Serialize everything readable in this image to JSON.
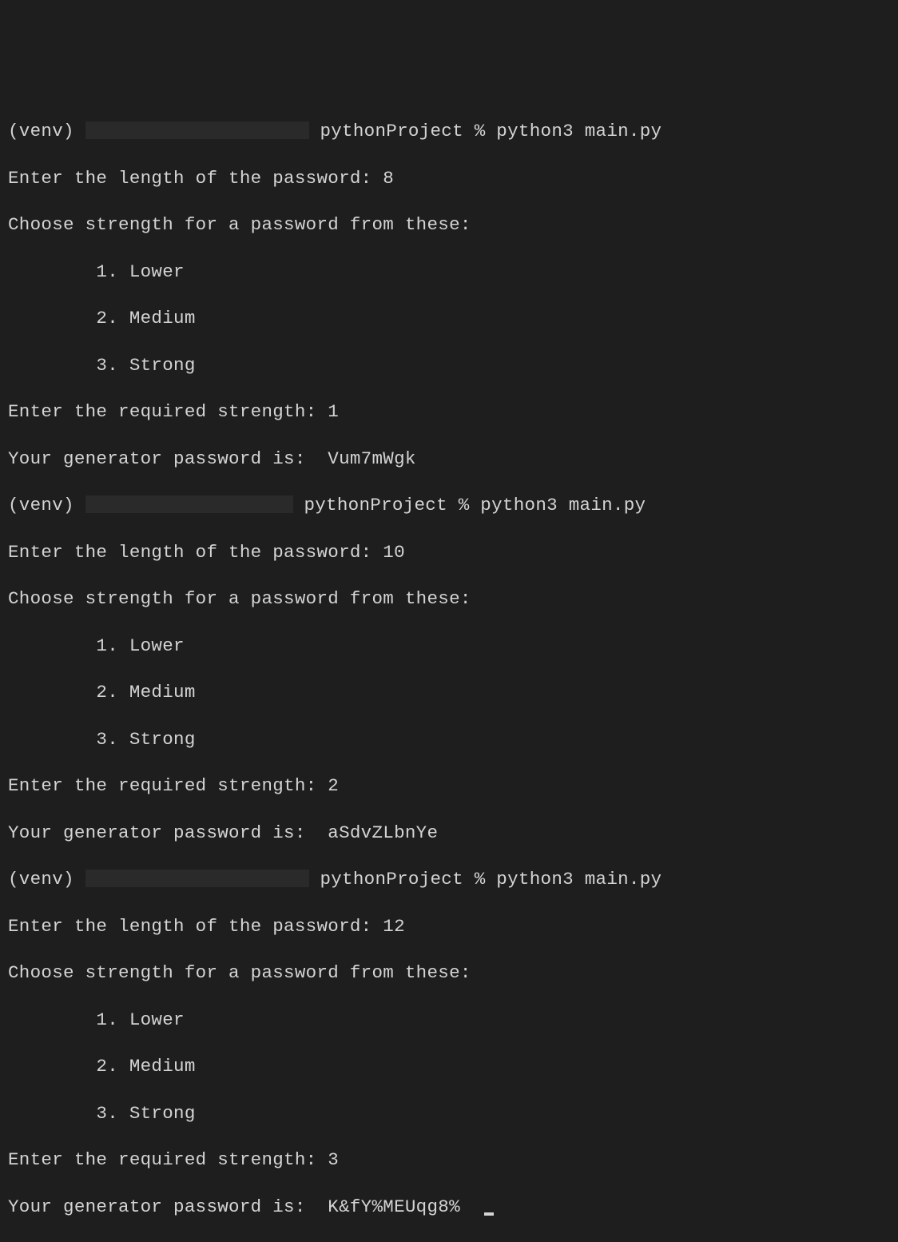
{
  "runs": [
    {
      "venv": "(venv)",
      "dir": "pythonProject",
      "cmd": "% python3 main.py",
      "length_prompt": "Enter the length of the password: ",
      "length_value": "8",
      "strength_header": "Choose strength for a password from these:",
      "options": [
        "        1. Lower",
        "        2. Medium",
        "        3. Strong"
      ],
      "strength_prompt": "Enter the required strength: ",
      "strength_value": "1",
      "result_prompt": "Your generator password is:  ",
      "result_value": "Vum7mWgk"
    },
    {
      "venv": "(venv)",
      "dir": "pythonProject",
      "cmd": "% python3 main.py",
      "length_prompt": "Enter the length of the password: ",
      "length_value": "10",
      "strength_header": "Choose strength for a password from these:",
      "options": [
        "        1. Lower",
        "        2. Medium",
        "        3. Strong"
      ],
      "strength_prompt": "Enter the required strength: ",
      "strength_value": "2",
      "result_prompt": "Your generator password is:  ",
      "result_value": "aSdvZLbnYe"
    },
    {
      "venv": "(venv)",
      "dir": "pythonProject",
      "cmd": "% python3 main.py",
      "length_prompt": "Enter the length of the password: ",
      "length_value": "12",
      "strength_header": "Choose strength for a password from these:",
      "options": [
        "        1. Lower",
        "        2. Medium",
        "        3. Strong"
      ],
      "strength_prompt": "Enter the required strength: ",
      "strength_value": "3",
      "result_prompt": "Your generator password is:  ",
      "result_value": "K&fY%MEUqg8%"
    }
  ]
}
